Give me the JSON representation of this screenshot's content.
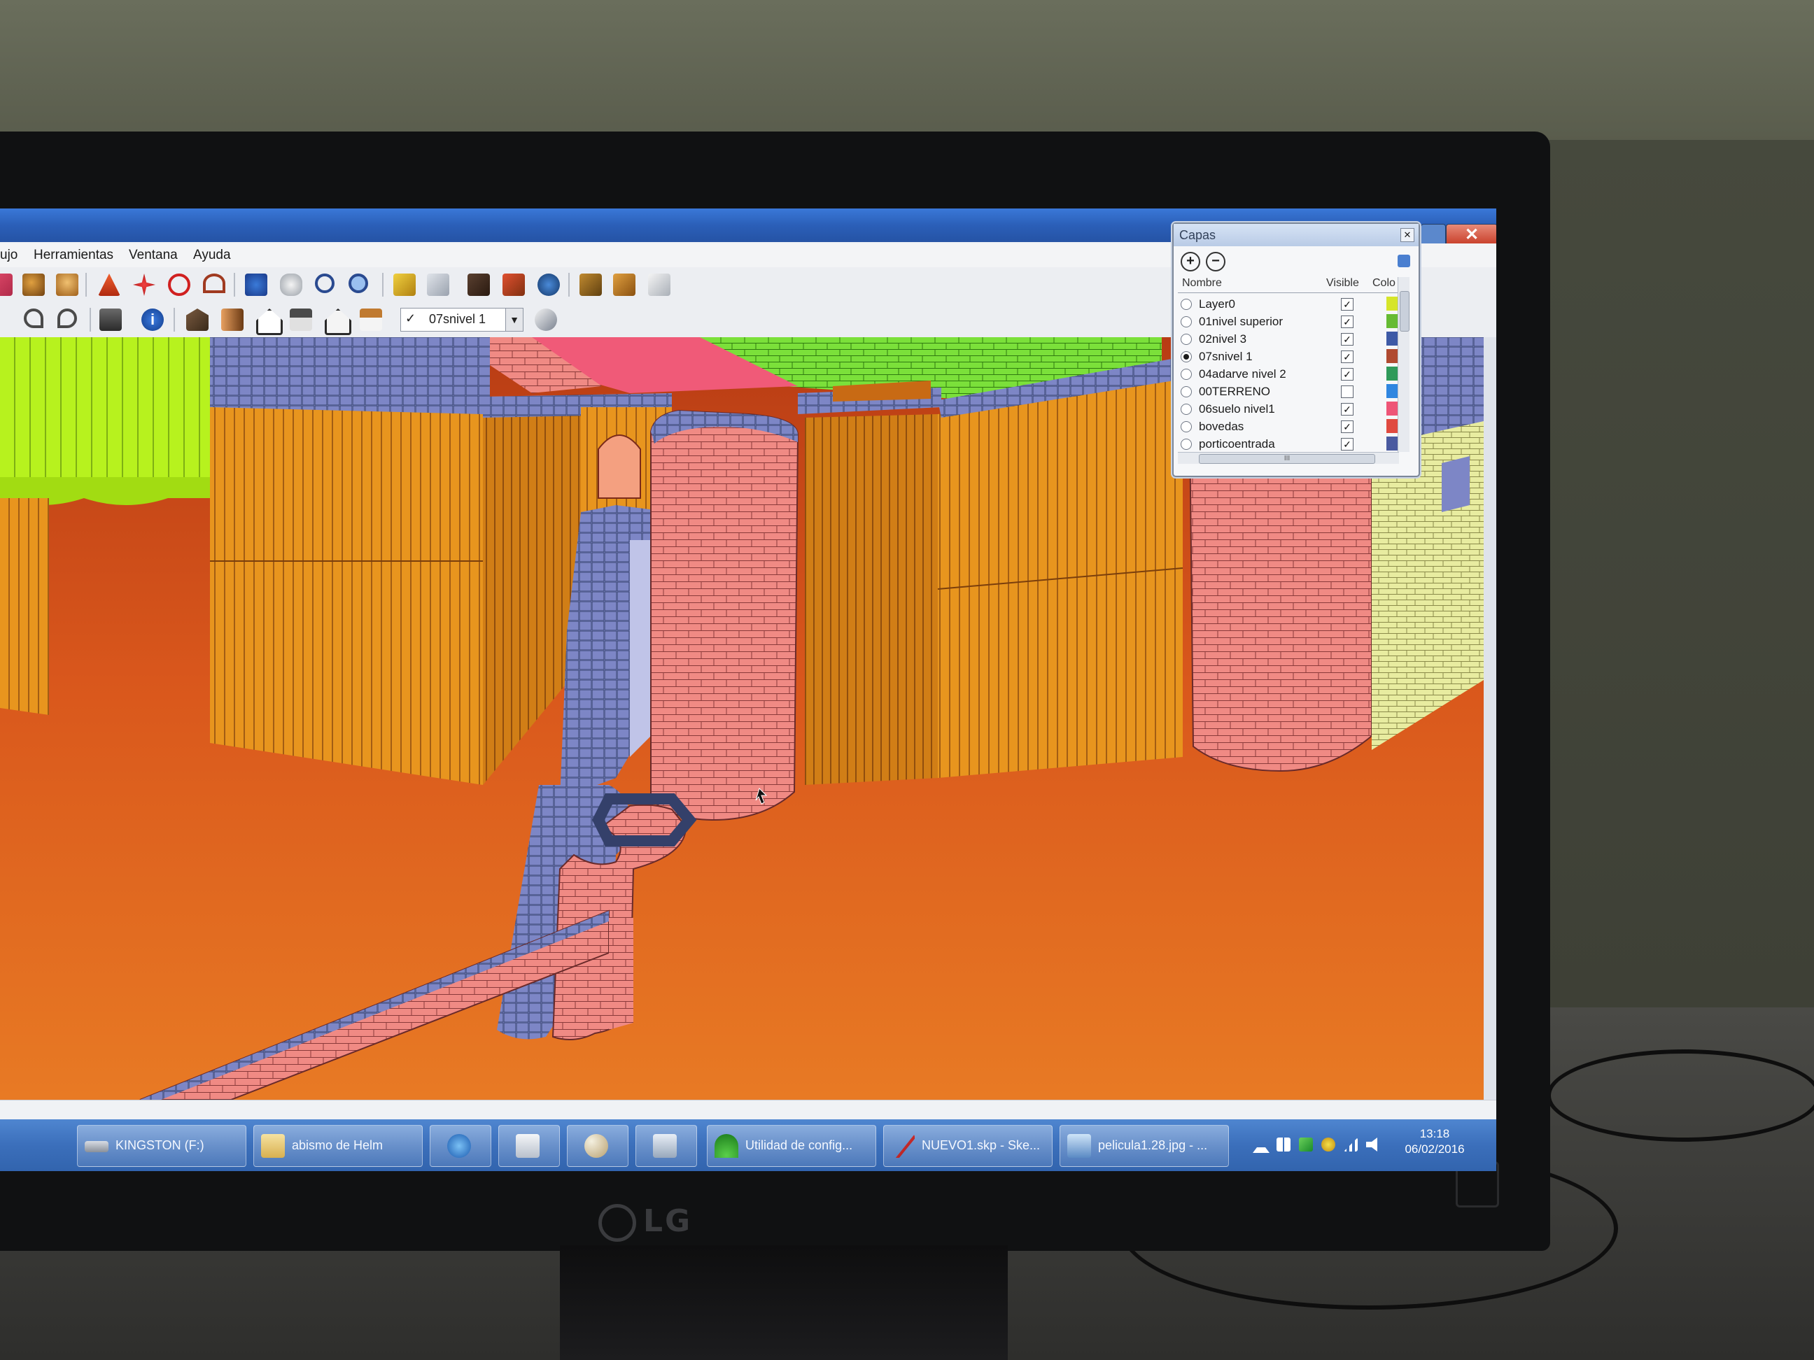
{
  "menu": {
    "items": [
      "ujo",
      "Herramientas",
      "Ventana",
      "Ayuda"
    ]
  },
  "toolbar": {
    "layer_select_value": "07snivel 1"
  },
  "icons": {
    "toolbar_row1": [
      "eraser-icon",
      "paint-bucket-icon",
      "push-pull-icon",
      "move-icon",
      "rotate-icon",
      "follow-me-icon",
      "offset-icon",
      "orbit-icon",
      "pan-icon",
      "zoom-icon",
      "zoom-extents-icon",
      "3d-warehouse-icon",
      "component-icon",
      "get-models-icon",
      "share-model-icon",
      "extension-icon",
      "sandbox-icon",
      "dynamic-component-icon",
      "style-icon"
    ],
    "toolbar_row2": [
      "undo-icon",
      "redo-icon",
      "print-icon",
      "model-info-icon",
      "iso-view-icon",
      "top-view-icon",
      "front-view-icon",
      "right-view-icon",
      "back-view-icon",
      "left-view-icon",
      "bottom-view-icon",
      "layer-manager-icon"
    ]
  },
  "layers_panel": {
    "title": "Capas",
    "header_name": "Nombre",
    "header_visible": "Visible",
    "header_color": "Colo",
    "scroll_mark": "III",
    "layers": [
      {
        "name": "Layer0",
        "visible": true,
        "active": false,
        "color": "#d6e52a"
      },
      {
        "name": "01nivel superior",
        "visible": true,
        "active": false,
        "color": "#66bb33"
      },
      {
        "name": "02nivel 3",
        "visible": true,
        "active": false,
        "color": "#3e5aa6"
      },
      {
        "name": "07snivel 1",
        "visible": true,
        "active": true,
        "color": "#b04a30"
      },
      {
        "name": "04adarve nivel 2",
        "visible": true,
        "active": false,
        "color": "#2f9a5a"
      },
      {
        "name": "00TERRENO",
        "visible": false,
        "active": false,
        "color": "#2f86e0"
      },
      {
        "name": "06suelo nivel1",
        "visible": true,
        "active": false,
        "color": "#ee5577"
      },
      {
        "name": "bovedas",
        "visible": true,
        "active": false,
        "color": "#e04a40"
      },
      {
        "name": "porticoentrada",
        "visible": true,
        "active": false,
        "color": "#4a5aa0"
      }
    ]
  },
  "taskbar": {
    "items": [
      {
        "label": "KINGSTON (F:)",
        "icon": "usb-drive-icon"
      },
      {
        "label": "abismo de Helm",
        "icon": "folder-icon"
      },
      {
        "label": "",
        "icon": "internet-explorer-icon"
      },
      {
        "label": "",
        "icon": "notepad-icon"
      },
      {
        "label": "",
        "icon": "paint-icon"
      },
      {
        "label": "",
        "icon": "explorer-icon"
      },
      {
        "label": "Utilidad de config...",
        "icon": "wireless-utility-icon"
      },
      {
        "label": "NUEVO1.skp - Ske...",
        "icon": "sketchup-icon"
      },
      {
        "label": "pelicula1.28.jpg - ...",
        "icon": "image-viewer-icon"
      }
    ],
    "clock_time": "13:18",
    "clock_date": "06/02/2016"
  },
  "monitor": {
    "brand": "LG"
  },
  "colors": {
    "ground": "#d9571c",
    "wall_orange": "#e8951e",
    "brick_pink": "#f08a84",
    "wall_lime": "#b7f21e",
    "roof_green": "#7be03a",
    "capstone": "#7d86c6",
    "titlebar": "#2b5fb8"
  }
}
